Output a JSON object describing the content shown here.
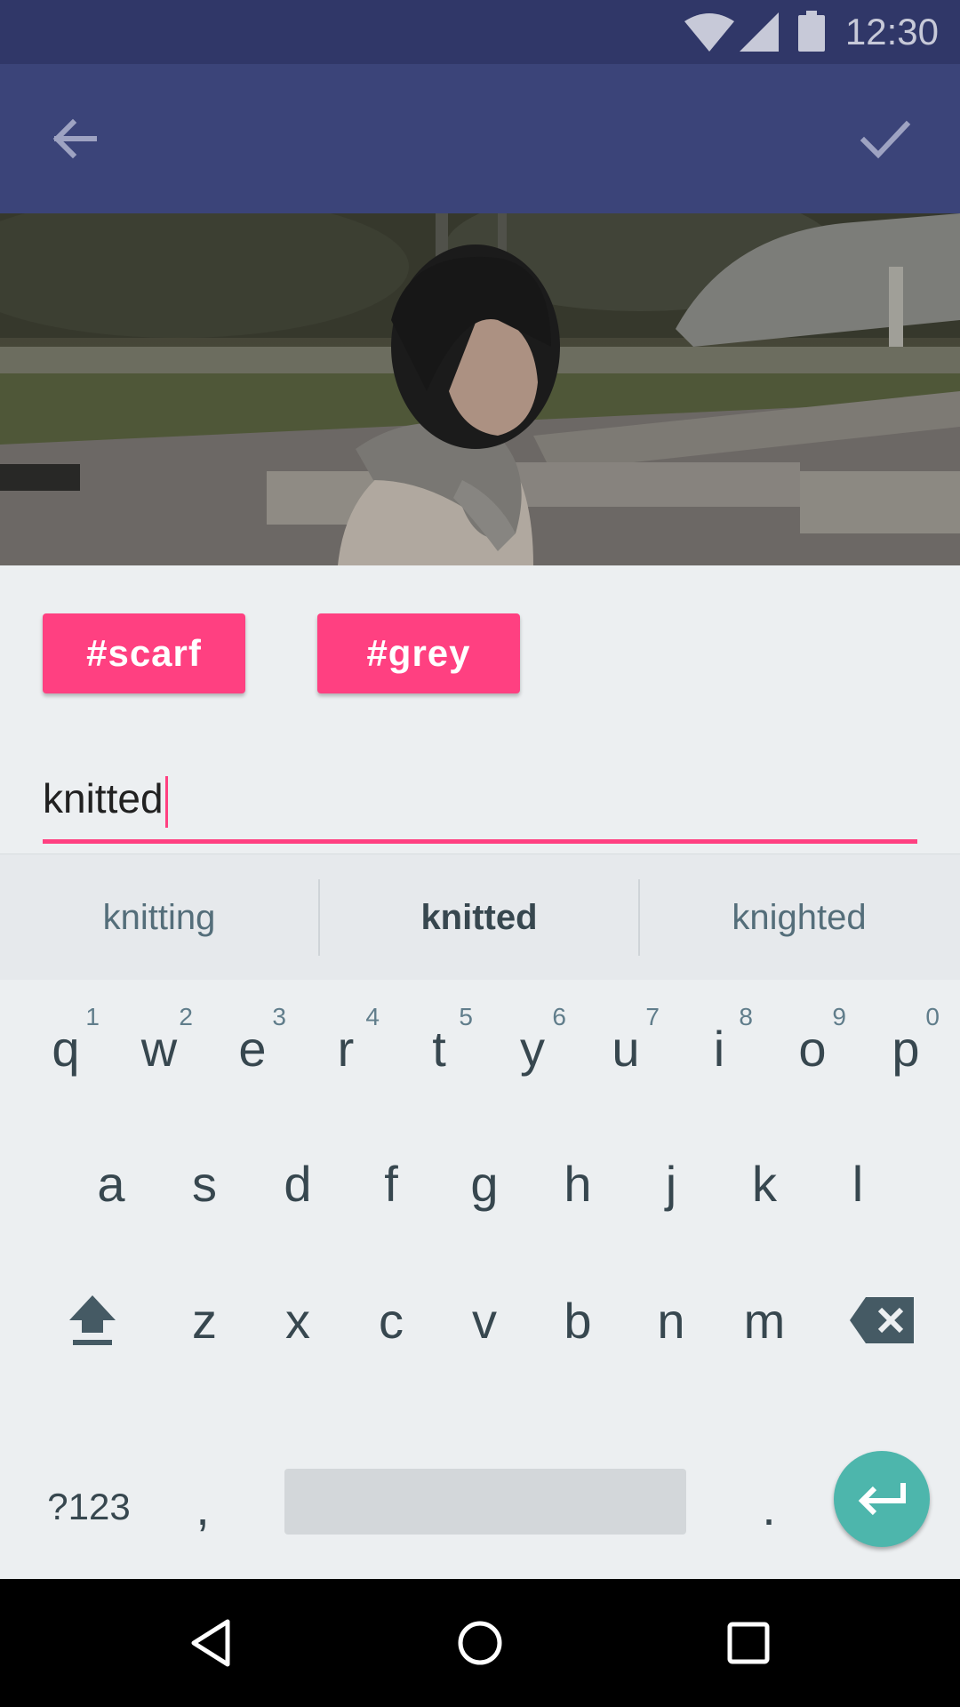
{
  "status_bar": {
    "time": "12:30"
  },
  "colors": {
    "primary_dark": "#303768",
    "primary": "#3b4479",
    "accent": "#ff4081",
    "enter": "#4db6ac"
  },
  "icons": {
    "back": "arrow-back-icon",
    "confirm": "check-icon",
    "enter": "return-icon",
    "shift": "shift-icon",
    "delete": "backspace-icon"
  },
  "tags": [
    {
      "label": "#scarf"
    },
    {
      "label": "#grey"
    }
  ],
  "tag_input": {
    "value": "knitted"
  },
  "suggestions": [
    "knitting",
    "knitted",
    "knighted"
  ],
  "keyboard": {
    "row1": [
      {
        "key": "q",
        "hint": "1"
      },
      {
        "key": "w",
        "hint": "2"
      },
      {
        "key": "e",
        "hint": "3"
      },
      {
        "key": "r",
        "hint": "4"
      },
      {
        "key": "t",
        "hint": "5"
      },
      {
        "key": "y",
        "hint": "6"
      },
      {
        "key": "u",
        "hint": "7"
      },
      {
        "key": "i",
        "hint": "8"
      },
      {
        "key": "o",
        "hint": "9"
      },
      {
        "key": "p",
        "hint": "0"
      }
    ],
    "row2": [
      "a",
      "s",
      "d",
      "f",
      "g",
      "h",
      "j",
      "k",
      "l"
    ],
    "row3": [
      "z",
      "x",
      "c",
      "v",
      "b",
      "n",
      "m"
    ],
    "symbols_label": "?123",
    "comma": ",",
    "period": "."
  }
}
